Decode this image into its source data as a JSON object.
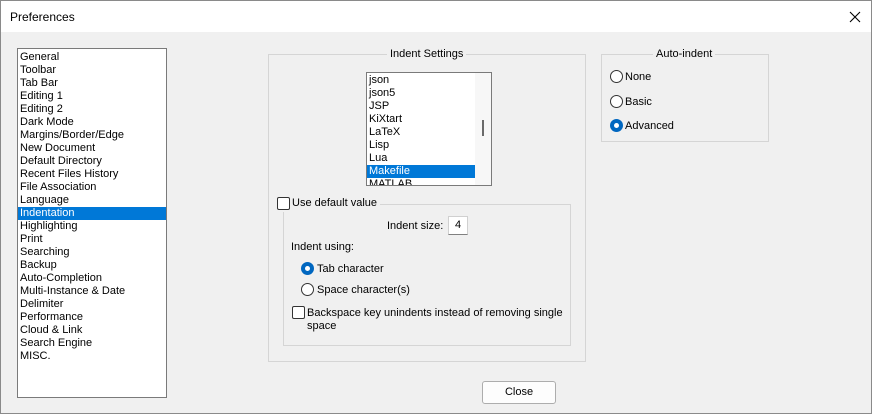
{
  "window": {
    "title": "Preferences"
  },
  "sidebar": {
    "items": [
      "General",
      "Toolbar",
      "Tab Bar",
      "Editing 1",
      "Editing 2",
      "Dark Mode",
      "Margins/Border/Edge",
      "New Document",
      "Default Directory",
      "Recent Files History",
      "File Association",
      "Language",
      "Indentation",
      "Highlighting",
      "Print",
      "Searching",
      "Backup",
      "Auto-Completion",
      "Multi-Instance & Date",
      "Delimiter",
      "Performance",
      "Cloud & Link",
      "Search Engine",
      "MISC."
    ],
    "selected": "Indentation"
  },
  "indent_settings": {
    "title": "Indent Settings",
    "languages": [
      "json",
      "json5",
      "JSP",
      "KiXtart",
      "LaTeX",
      "Lisp",
      "Lua",
      "Makefile",
      "MATLAB"
    ],
    "selected_language": "Makefile",
    "use_default_label": "Use default value",
    "use_default_checked": false,
    "indent_size_label": "Indent size:",
    "indent_size_value": "4",
    "indent_using_label": "Indent using:",
    "tab_label": "Tab character",
    "space_label": "Space character(s)",
    "indent_using_selected": "tab",
    "backspace_label_line1": "Backspace key unindents instead of removing single",
    "backspace_label_line2": "space",
    "backspace_checked": false
  },
  "auto_indent": {
    "title": "Auto-indent",
    "options": [
      "None",
      "Basic",
      "Advanced"
    ],
    "selected": "Advanced"
  },
  "footer": {
    "close_label": "Close"
  },
  "colors": {
    "selection": "#0078d7",
    "radio_accent": "#0067c0"
  }
}
